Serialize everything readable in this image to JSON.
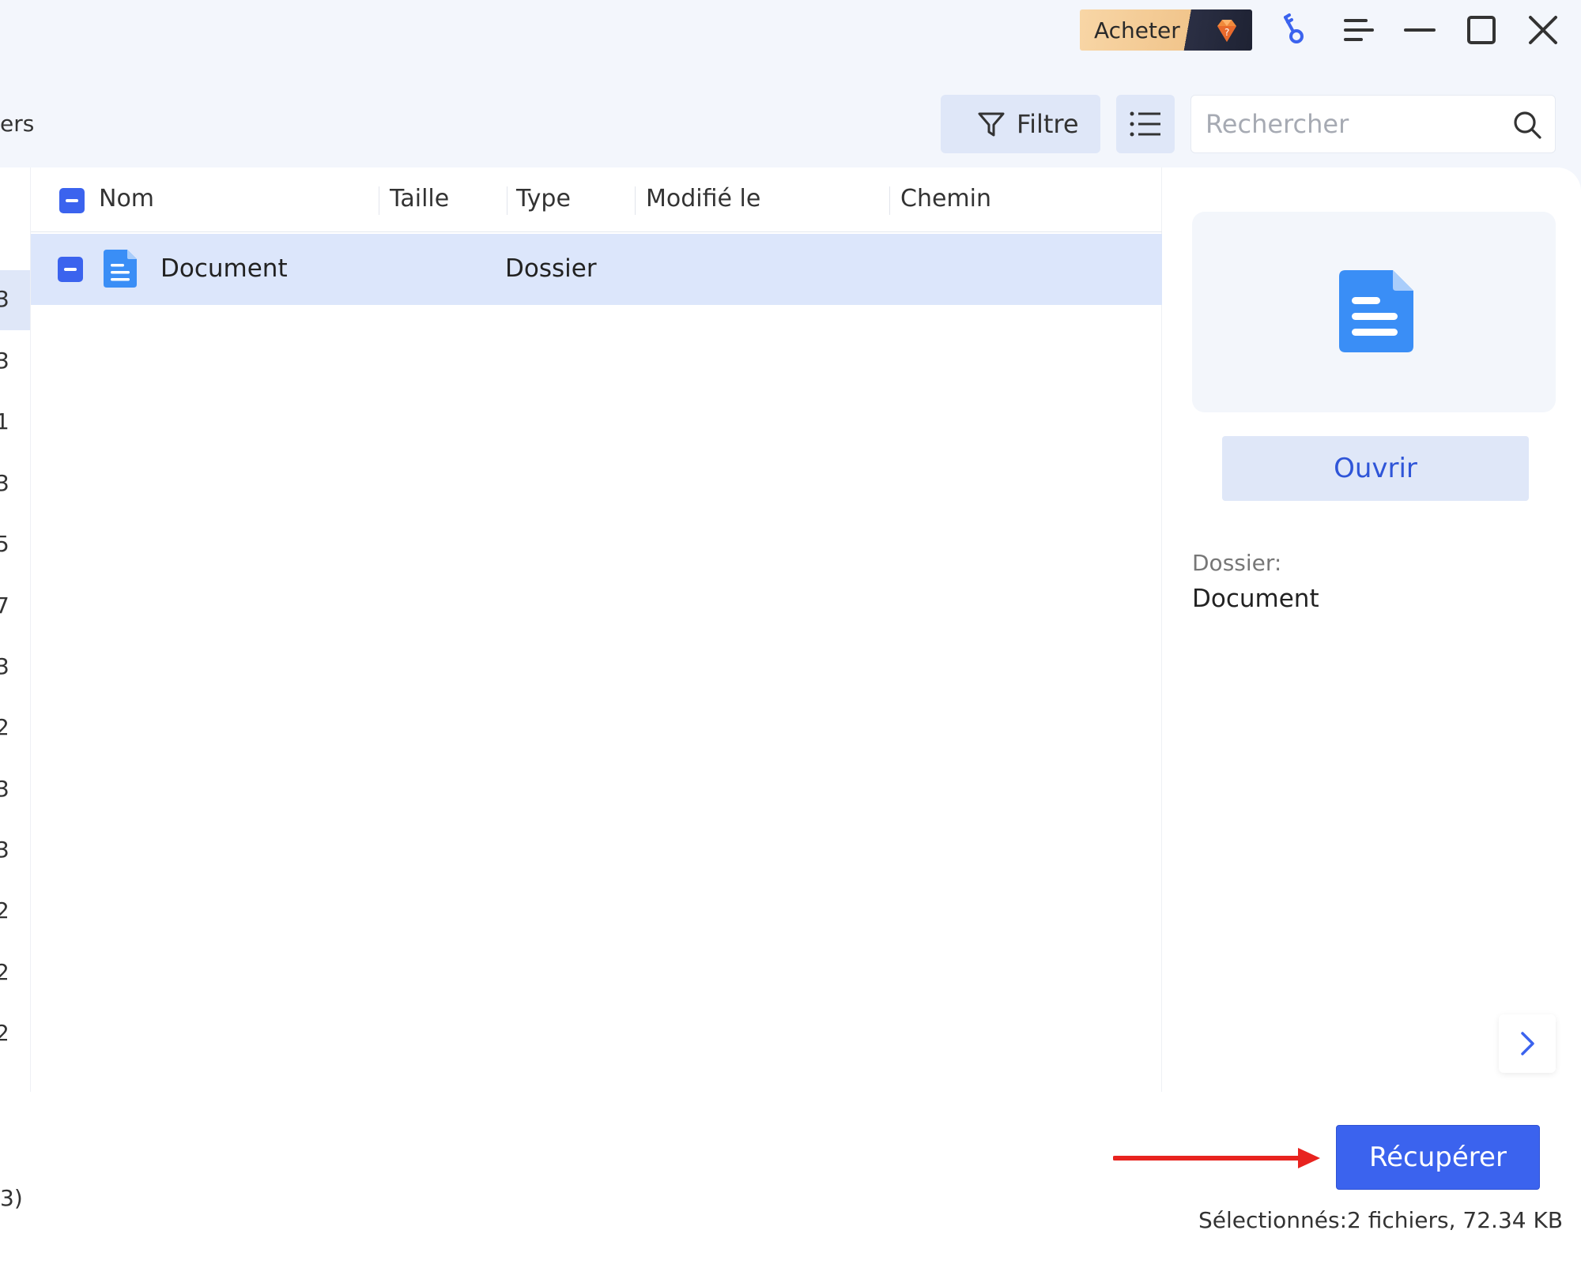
{
  "window": {
    "buy_label": "Acheter",
    "buy_colors": {
      "light": "#f8d6a6",
      "dark": "#1e2233"
    },
    "icons": [
      "key-icon",
      "menu-icon",
      "minimize-icon",
      "maximize-icon",
      "close-icon"
    ]
  },
  "toolbar": {
    "partial_left_text": "ers",
    "filter_label": "Filtre",
    "view_toggle_icon": "list-view-icon",
    "search_placeholder": "Rechercher"
  },
  "sidebar": {
    "partial_numbers": [
      "3",
      "3",
      "1",
      "3",
      "5",
      "7",
      "3",
      "2",
      "3",
      "3",
      "2",
      "2",
      "2"
    ],
    "active_index": 0
  },
  "table": {
    "headers": [
      "Nom",
      "Taille",
      "Type",
      "Modifié le",
      "Chemin"
    ],
    "header_checkbox": "partial",
    "rows": [
      {
        "name": "Document",
        "size": "",
        "type": "Dossier",
        "modified": "",
        "path": "",
        "selected": true,
        "checkbox": "partial",
        "icon": "document-icon"
      }
    ]
  },
  "details": {
    "preview_icon": "document-icon",
    "open_label": "Ouvrir",
    "type_label": "Dossier:",
    "name_value": "Document"
  },
  "footer": {
    "partial_left_text": "3)",
    "recover_label": "Récupérer",
    "status": "Sélectionnés:2 fichiers, 72.34 KB",
    "accent_color": "#3b63ee",
    "arrow_color": "#e8231f"
  }
}
